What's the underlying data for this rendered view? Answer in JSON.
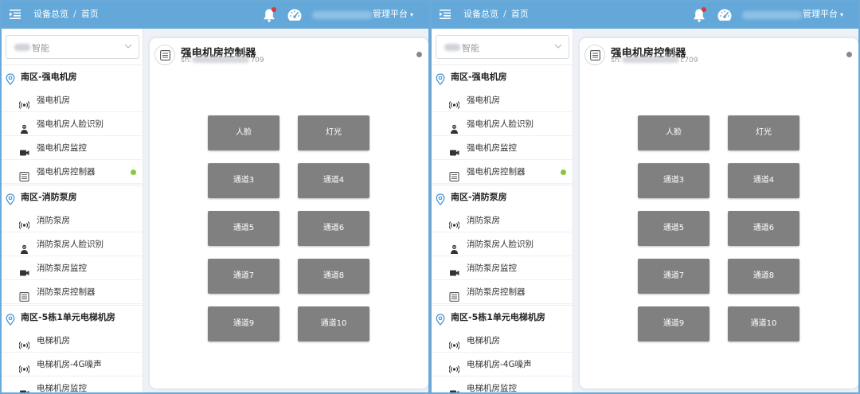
{
  "colors": {
    "topbar": "#63a8d8",
    "frame": "#6aa9d8",
    "button": "#808080",
    "online": "#8cc63f",
    "status": "#888888"
  },
  "header": {
    "menu_icon": "menu-fold-icon",
    "breadcrumb": [
      "设备总览",
      "首页"
    ],
    "breadcrumb_sep": "/",
    "platform_label": "管理平台",
    "platform_caret": "▾",
    "icons": [
      "bell-icon",
      "dashboard-gauge-icon"
    ]
  },
  "sidebar": {
    "selector_text": "智能",
    "groups": [
      {
        "title": "南区-强电机房",
        "items": [
          {
            "label": "强电机房",
            "icon": "broadcast-icon",
            "online": false
          },
          {
            "label": "强电机房人脸识别",
            "icon": "face-recognition-icon",
            "online": false
          },
          {
            "label": "强电机房监控",
            "icon": "camera-icon",
            "online": false
          },
          {
            "label": "强电机房控制器",
            "icon": "controller-icon",
            "online": true
          }
        ]
      },
      {
        "title": "南区-消防泵房",
        "items": [
          {
            "label": "消防泵房",
            "icon": "broadcast-icon",
            "online": false
          },
          {
            "label": "消防泵房人脸识别",
            "icon": "face-recognition-icon",
            "online": false
          },
          {
            "label": "消防泵房监控",
            "icon": "camera-icon",
            "online": false
          },
          {
            "label": "消防泵房控制器",
            "icon": "controller-icon",
            "online": false
          }
        ]
      },
      {
        "title": "南区-5栋1单元电梯机房",
        "items": [
          {
            "label": "电梯机房",
            "icon": "broadcast-icon",
            "online": false
          },
          {
            "label": "电梯机房-4G噪声",
            "icon": "broadcast-icon",
            "online": false
          },
          {
            "label": "电梯机房监控",
            "icon": "camera-icon",
            "online": false
          }
        ]
      }
    ]
  },
  "panels": [
    {
      "title": "强电机房控制器",
      "sn_prefix": "sn:",
      "sn_suffix": "709",
      "buttons": [
        "人脸",
        "灯光",
        "通道3",
        "通道4",
        "通道5",
        "通道6",
        "通道7",
        "通道8",
        "通道9",
        "通道10"
      ]
    },
    {
      "title": "强电机房控制器",
      "sn_prefix": "sn:",
      "sn_suffix": "c709",
      "buttons": [
        "人脸",
        "灯光",
        "通道3",
        "通道4",
        "通道5",
        "通道6",
        "通道7",
        "通道8",
        "通道9",
        "通道10"
      ]
    }
  ]
}
